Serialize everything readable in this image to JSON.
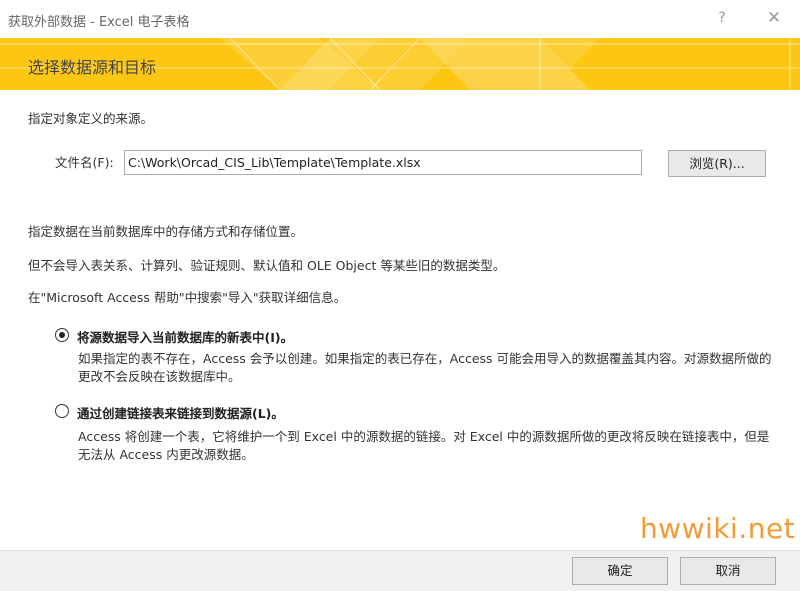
{
  "window": {
    "title": "获取外部数据 - Excel 电子表格",
    "help_glyph": "?",
    "close_glyph": "✕"
  },
  "banner": {
    "title": "选择数据源和目标",
    "color": "#fdc612"
  },
  "source": {
    "intro": "指定对象定义的来源。",
    "file_label": "文件名(F):",
    "file_value": "C:\\Work\\Orcad_CIS_Lib\\Template\\Template.xlsx",
    "browse_label": "浏览(R)..."
  },
  "storage": {
    "line1": "指定数据在当前数据库中的存储方式和存储位置。",
    "line2": "但不会导入表关系、计算列、验证规则、默认值和 OLE Object 等某些旧的数据类型。",
    "line3": "在\"Microsoft Access 帮助\"中搜索\"导入\"获取详细信息。"
  },
  "options": [
    {
      "label": "将源数据导入当前数据库的新表中(I)。",
      "checked": true,
      "desc": "如果指定的表不存在，Access 会予以创建。如果指定的表已存在，Access 可能会用导入的数据覆盖其内容。对源数据所做的更改不会反映在该数据库中。"
    },
    {
      "label": "通过创建链接表来链接到数据源(L)。",
      "checked": false,
      "desc": "Access 将创建一个表，它将维护一个到 Excel 中的源数据的链接。对 Excel 中的源数据所做的更改将反映在链接表中，但是无法从 Access 内更改源数据。"
    }
  ],
  "watermark": "hwwiki.net",
  "footer": {
    "ok_label": "确定",
    "cancel_label": "取消"
  }
}
